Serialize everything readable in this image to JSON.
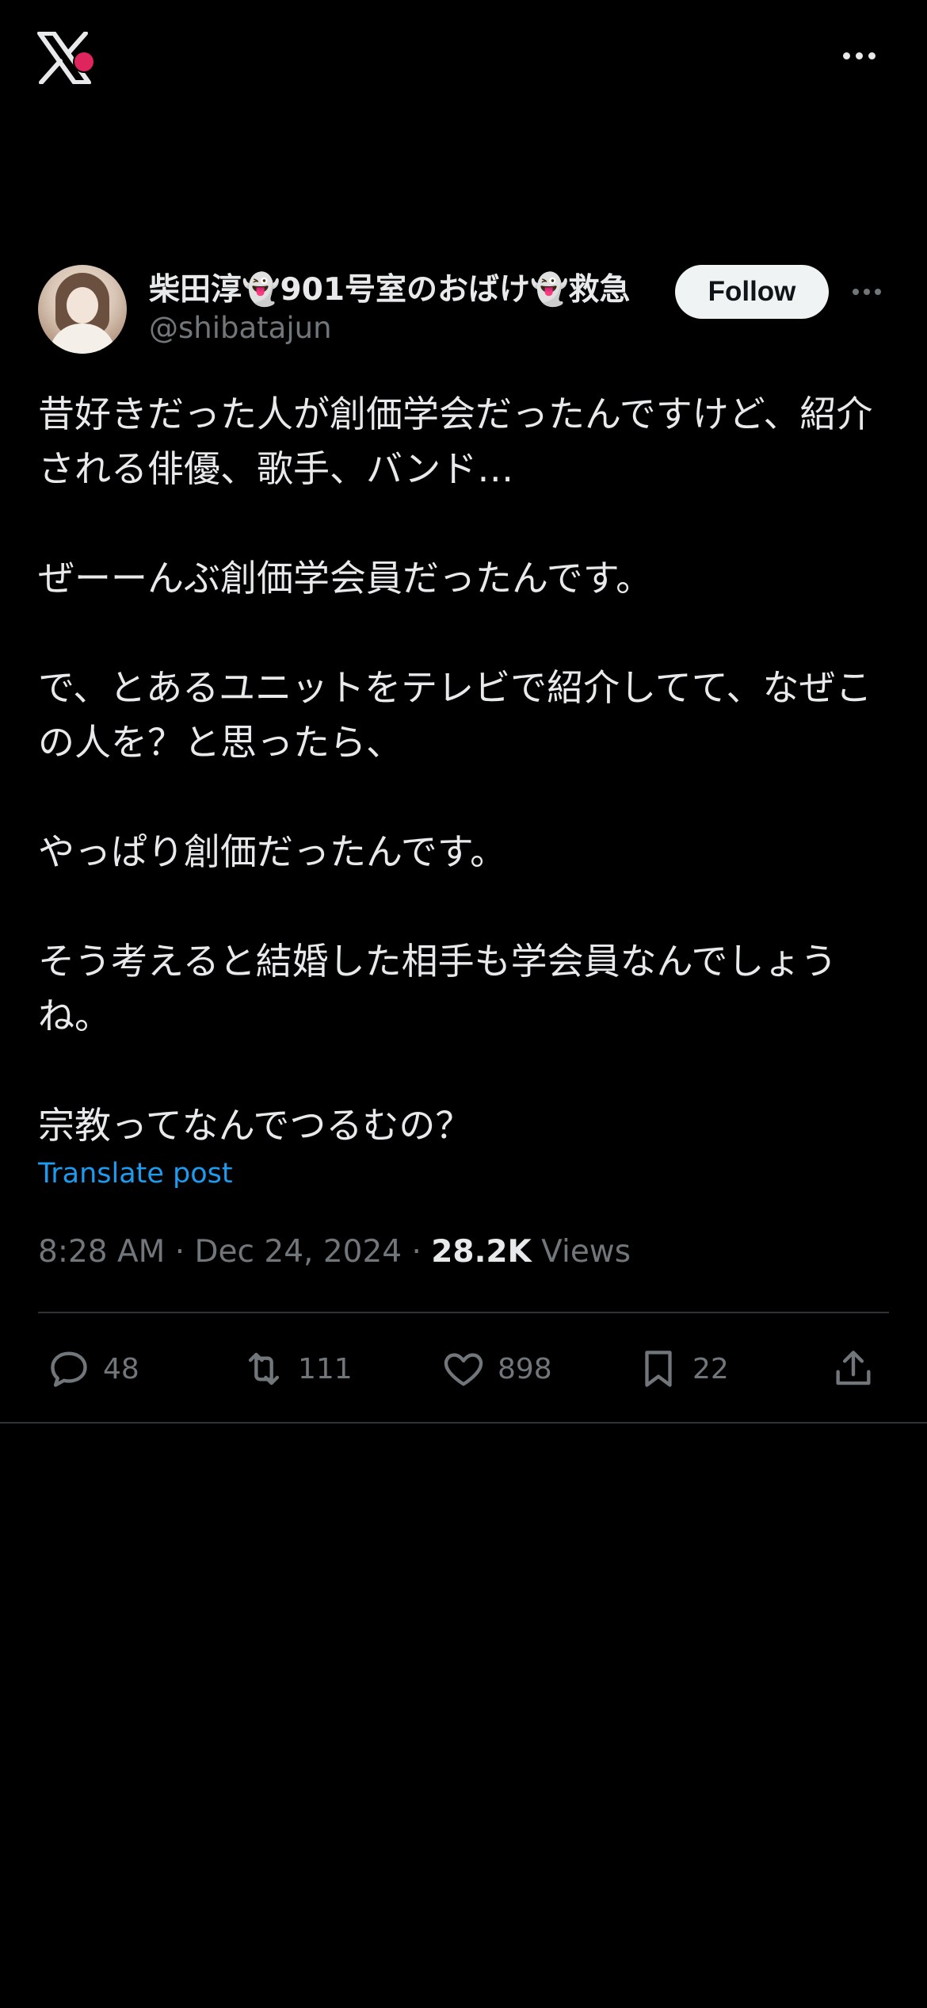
{
  "topbar": {
    "logo_icon": "x-logo-icon",
    "more_icon": "more-horizontal-icon"
  },
  "author": {
    "display_name": "柴田淳👻901号室のおばけ👻救急",
    "handle": "@shibatajun",
    "follow_label": "Follow"
  },
  "tweet": {
    "paragraphs": [
      "昔好きだった人が創価学会だったんですけど、紹介される俳優、歌手、バンド…",
      "ぜーーんぶ創価学会員だったんです。",
      "で、とあるユニットをテレビで紹介してて、なぜこの人を？と思ったら、",
      "やっぱり創価だったんです。",
      "そう考えると結婚した相手も学会員なんでしょうね。",
      "宗教ってなんでつるむの？"
    ],
    "translate_label": "Translate post",
    "time": "8:28 AM",
    "date": "Dec 24, 2024",
    "views_count": "28.2K",
    "views_label": "Views",
    "sep": "·"
  },
  "actions": {
    "replies": "48",
    "reposts": "111",
    "likes": "898",
    "bookmarks": "22"
  },
  "colors": {
    "background": "#000000",
    "accent": "#1d9bf0",
    "muted": "#71767b",
    "text": "#e7e9ea"
  }
}
